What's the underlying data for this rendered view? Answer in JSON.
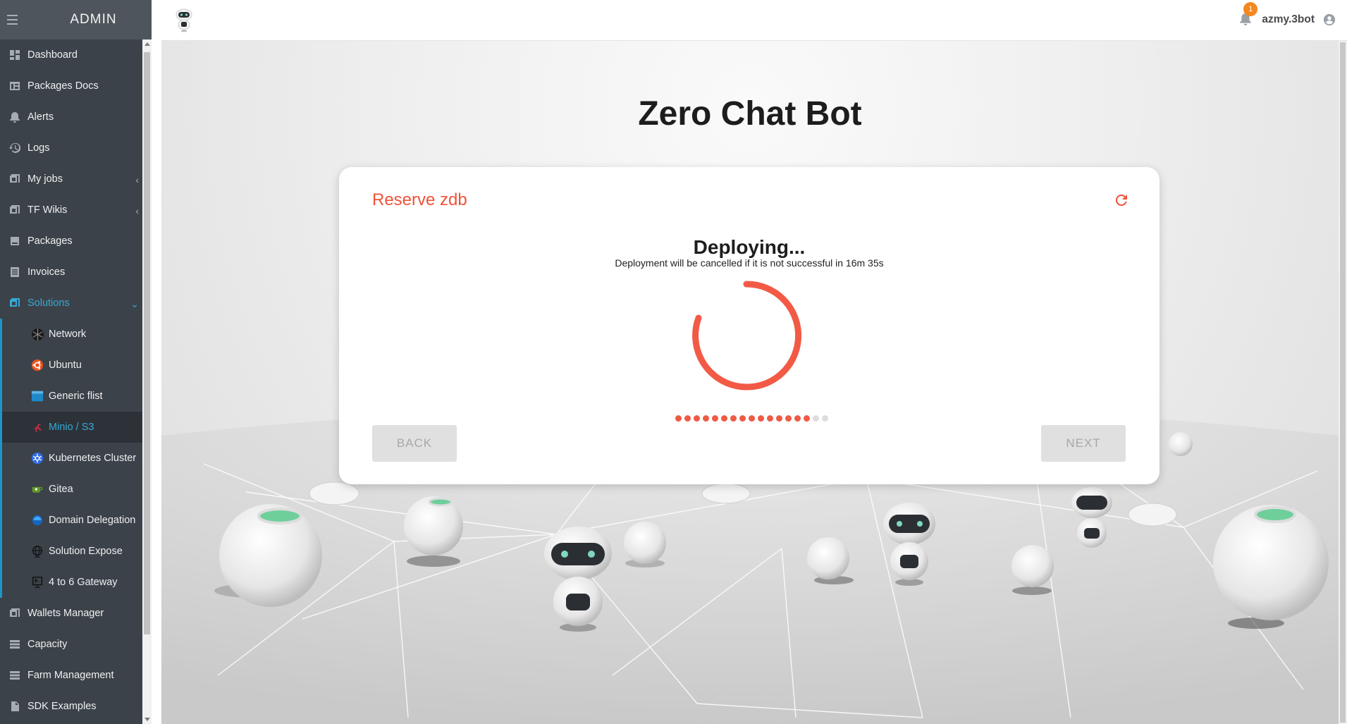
{
  "sidebar": {
    "title": "ADMIN",
    "items": [
      {
        "label": "Dashboard",
        "icon": "dashboard-icon"
      },
      {
        "label": "Packages Docs",
        "icon": "docs-icon"
      },
      {
        "label": "Alerts",
        "icon": "bell-icon"
      },
      {
        "label": "Logs",
        "icon": "history-icon"
      },
      {
        "label": "My jobs",
        "icon": "jobs-icon"
      },
      {
        "label": "TF Wikis",
        "icon": "wiki-icon"
      },
      {
        "label": "Packages",
        "icon": "package-icon"
      },
      {
        "label": "Invoices",
        "icon": "invoice-icon"
      },
      {
        "label": "Solutions",
        "icon": "solutions-icon"
      }
    ],
    "solutions": [
      {
        "label": "Network",
        "icon": "network-icon"
      },
      {
        "label": "Ubuntu",
        "icon": "ubuntu-icon"
      },
      {
        "label": "Generic flist",
        "icon": "flist-icon"
      },
      {
        "label": "Minio / S3",
        "icon": "minio-icon"
      },
      {
        "label": "Kubernetes Cluster",
        "icon": "kubernetes-icon"
      },
      {
        "label": "Gitea",
        "icon": "gitea-icon"
      },
      {
        "label": "Domain Delegation",
        "icon": "domain-icon"
      },
      {
        "label": "Solution Expose",
        "icon": "globe-icon"
      },
      {
        "label": "4 to 6 Gateway",
        "icon": "gateway-icon"
      }
    ],
    "bottom_items": [
      {
        "label": "Wallets Manager",
        "icon": "wallet-icon"
      },
      {
        "label": "Capacity",
        "icon": "capacity-icon"
      },
      {
        "label": "Farm Management",
        "icon": "farm-icon"
      },
      {
        "label": "SDK Examples",
        "icon": "sdk-icon"
      }
    ]
  },
  "topbar": {
    "notification_count": "1",
    "username": "azmy.3bot"
  },
  "main": {
    "title": "Zero Chat Bot",
    "card": {
      "title": "Reserve zdb",
      "status": "Deploying...",
      "message": "Deployment will be cancelled if it is not successful in 16m 35s",
      "progress": {
        "completed_steps": 15,
        "total_steps": 17
      },
      "back_label": "BACK",
      "next_label": "NEXT"
    }
  },
  "colors": {
    "accent": "#f05239",
    "sidebar_bg": "#3c4249",
    "sidebar_active": "#36a9d6"
  }
}
